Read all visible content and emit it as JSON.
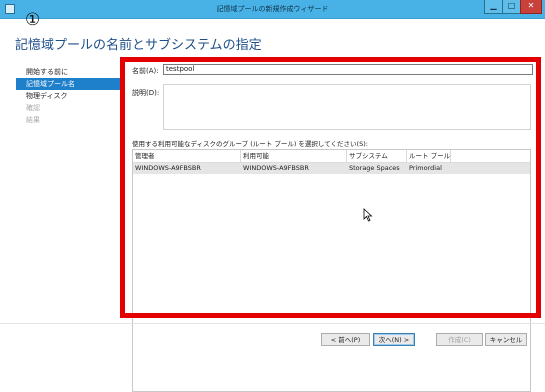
{
  "window": {
    "title": "記憶域プールの新規作成ウィザード",
    "minimize_glyph": "▁",
    "maximize_glyph": "□",
    "close_glyph": "✕"
  },
  "annotation": "①",
  "page_title": "記憶域プールの名前とサブシステムの指定",
  "nav": {
    "items": [
      {
        "label": "開始する前に",
        "state": "normal"
      },
      {
        "label": "記憶域プール名",
        "state": "active"
      },
      {
        "label": "物理ディスク",
        "state": "normal"
      },
      {
        "label": "確認",
        "state": "disabled"
      },
      {
        "label": "結果",
        "state": "disabled"
      }
    ]
  },
  "form": {
    "name_label": "名前(A):",
    "name_value": "testpool",
    "description_label": "説明(D):",
    "description_value": "",
    "group_label": "使用する利用可能なディスクのグループ (ルート プール) を選択してください(S):"
  },
  "table": {
    "columns": [
      "管理者",
      "利用可能",
      "サブシステム",
      "ルート プール"
    ],
    "rows": [
      [
        "WINDOWS-A9FBSBR",
        "WINDOWS-A9FBSBR",
        "Storage Spaces",
        "Primordial"
      ]
    ]
  },
  "buttons": {
    "prev": "< 前へ(P)",
    "next": "次へ(N) >",
    "create": "作成(C)",
    "cancel": "キャンセル"
  },
  "colors": {
    "titlebar": "#48b2e6",
    "nav_active": "#1e7fcb",
    "highlight_box": "#e50000",
    "page_title": "#1e4f8a"
  }
}
